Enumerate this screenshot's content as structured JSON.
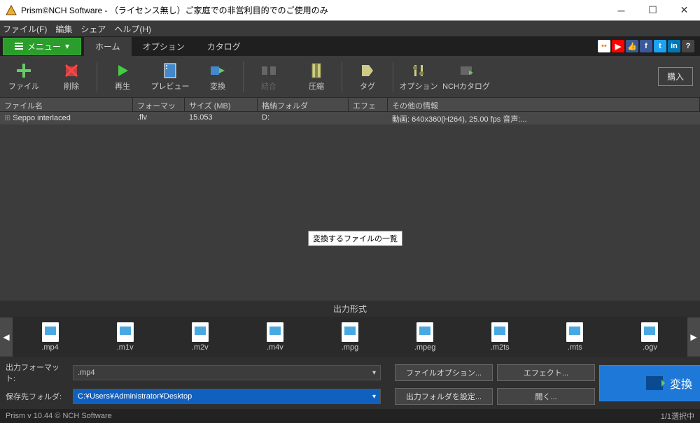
{
  "window": {
    "title": "Prism©NCH Software - （ライセンス無し）ご家庭での非営利目的でのご使用のみ"
  },
  "menubar": [
    "ファイル(F)",
    "編集",
    "シェア",
    "ヘルプ(H)"
  ],
  "tabrow": {
    "menu": "メニュー",
    "tabs": [
      "ホーム",
      "オプション",
      "カタログ"
    ]
  },
  "toolbar": {
    "file": "ファイル",
    "delete": "削除",
    "play": "再生",
    "preview": "プレビュー",
    "convert": "変換",
    "combine": "結合",
    "compress": "圧縮",
    "tag": "タグ",
    "option": "オプション",
    "catalog": "NCHカタログ",
    "buy": "購入"
  },
  "columns": [
    "ファイル名",
    "フォーマット",
    "サイズ (MB)",
    "格納フォルダ",
    "エフェクト",
    "その他の情報"
  ],
  "rows": [
    {
      "name": "Seppo interlaced",
      "format": ".flv",
      "size": "15.053",
      "folder": "D:",
      "effect": "",
      "info": "動画: 640x360(H264), 25.00 fps 音声:..."
    }
  ],
  "tooltip": "変換するファイルの一覧",
  "output_label": "出力形式",
  "formats": [
    ".mp4",
    ".m1v",
    ".m2v",
    ".m4v",
    ".mpg",
    ".mpeg",
    ".m2ts",
    ".mts",
    ".ogv"
  ],
  "controls": {
    "format_label": "出力フォーマット:",
    "format_value": ".mp4",
    "folder_label": "保存先フォルダ:",
    "folder_value": "C:¥Users¥Administrator¥Desktop",
    "file_option": "ファイルオプション...",
    "output_folder_set": "出力フォルダを設定...",
    "effect": "エフェクト...",
    "open": "開く...",
    "convert": "変換"
  },
  "status": {
    "left": "Prism v 10.44 © NCH Software",
    "right": "1/1選択中"
  },
  "colors": {
    "accent_green": "#2a9d2a",
    "accent_blue": "#1e78d8",
    "select_blue": "#1060c0"
  }
}
